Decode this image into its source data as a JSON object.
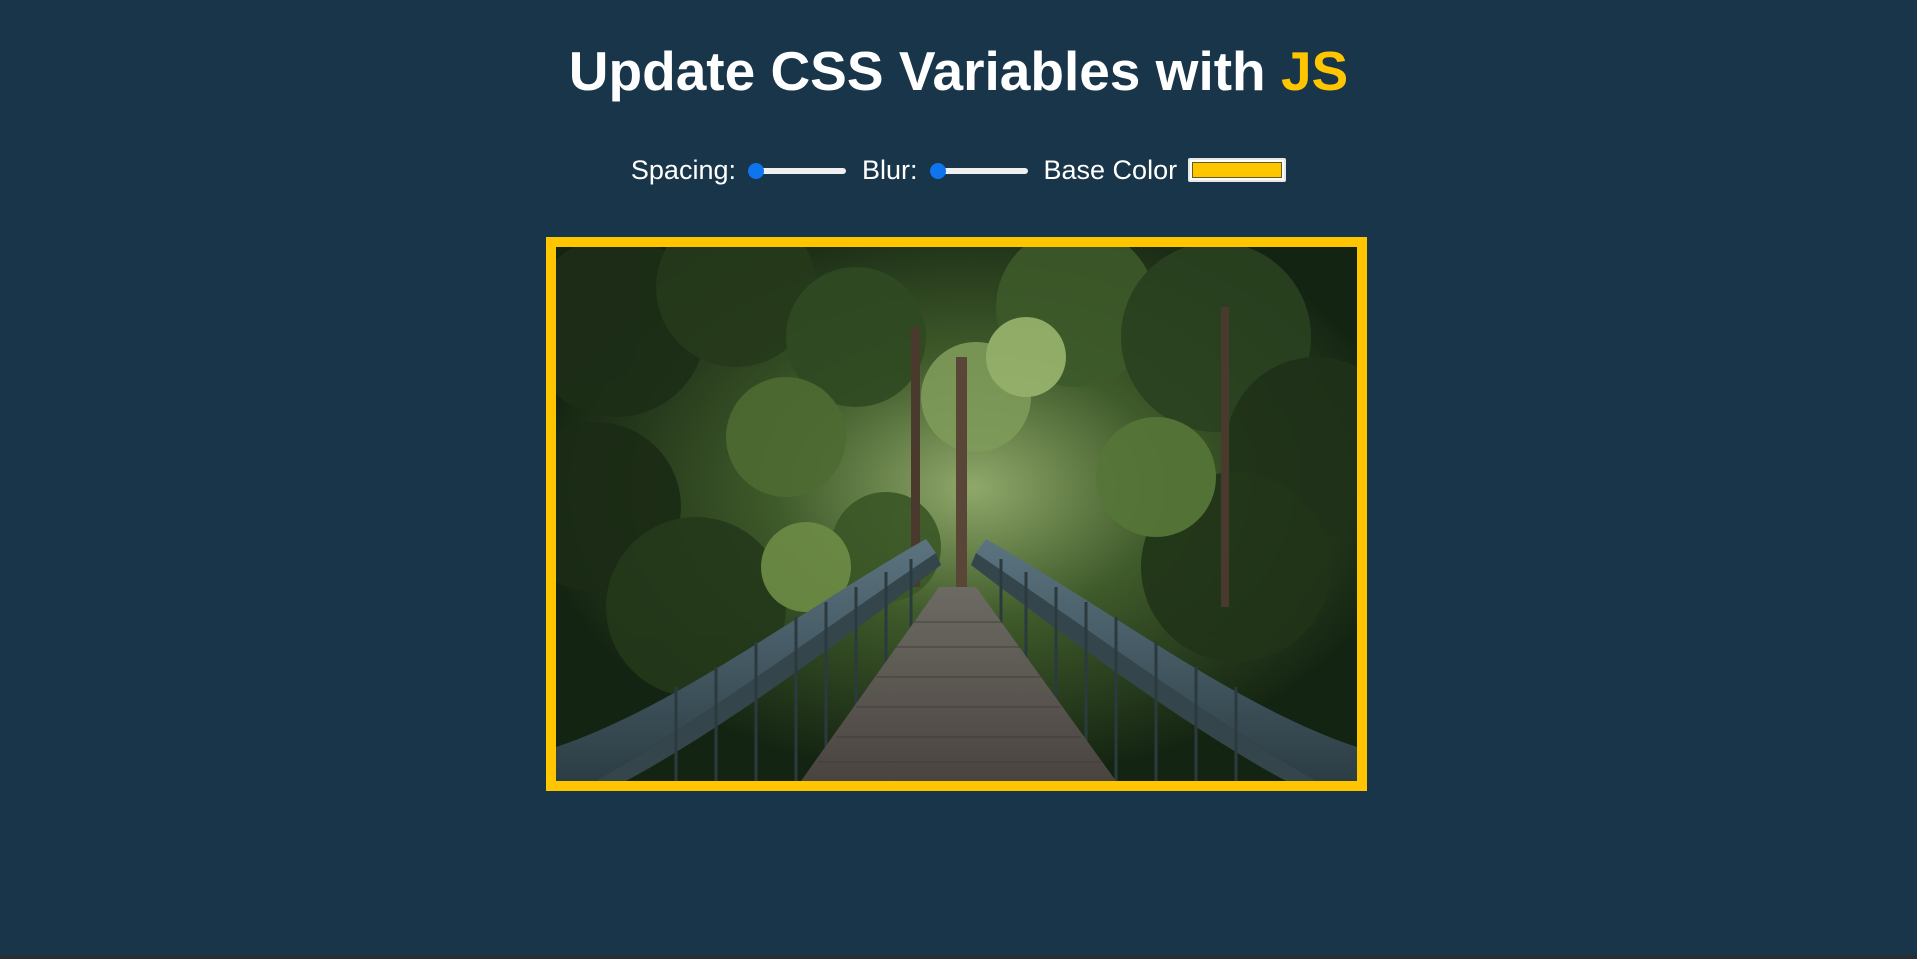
{
  "header": {
    "title_prefix": "Update CSS Variables with",
    "title_highlight": "JS"
  },
  "controls": {
    "spacing_label": "Spacing:",
    "spacing_value": 10,
    "spacing_min": 10,
    "spacing_max": 200,
    "blur_label": "Blur:",
    "blur_value": 0,
    "blur_min": 0,
    "blur_max": 25,
    "base_label": "Base Color",
    "base_value": "#ffc600"
  },
  "colors": {
    "background": "#193549",
    "accent": "#ffc600",
    "slider": "#0f75ef"
  },
  "image": {
    "subject": "forest-bridge-photo"
  }
}
